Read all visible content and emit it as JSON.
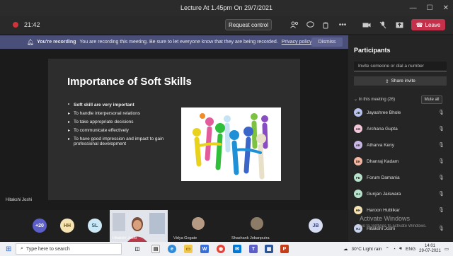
{
  "window": {
    "title": "Lecture At 1.45pm On 29/7/2021",
    "controls": [
      "—",
      "☐",
      "✕"
    ]
  },
  "toolbar": {
    "timer": "21:42",
    "request_control": "Request control",
    "leave_label": "Leave",
    "icons": [
      "participants-icon",
      "chat-icon",
      "reactions-icon",
      "more-icon",
      "camera-off-icon",
      "mic-off-icon",
      "share-icon"
    ]
  },
  "banner": {
    "title": "You're recording",
    "message": "You are recording this meeting. Be sure to let everyone know that they are being recorded.",
    "link": "Privacy policy",
    "dismiss": "Dismiss"
  },
  "slide": {
    "title": "Importance of Soft Skills",
    "bullets": [
      {
        "text": "Soft skill are very important",
        "main": true
      },
      {
        "text": "To handle interpersonal relations",
        "main": false
      },
      {
        "text": "To take appropriate decisions",
        "main": false
      },
      {
        "text": "To communicate effectively",
        "main": false
      },
      {
        "text": "To have good impression and impact to gain professional development",
        "main": false
      }
    ]
  },
  "presenter_name": "Hitakshi Joshi",
  "tiles": [
    {
      "initials": "+20",
      "color": "#5b5fc7",
      "text_color": "#ffffff"
    },
    {
      "initials": "HH",
      "color": "#f6e3b4",
      "text_color": "#6b5316"
    },
    {
      "initials": "SL",
      "color": "#cde8f5",
      "text_color": "#2b5d75"
    },
    {
      "initials": "JB",
      "color": "#d6dcf2",
      "text_color": "#3a4578"
    }
  ],
  "tile_names": {
    "video": "Hitakshi Joshi",
    "vidya": "Vidya Gogate",
    "shashank": "Shashank Jobanputra"
  },
  "participants": {
    "title": "Participants",
    "invite_placeholder": "Invite someone or dial a number",
    "share_invite": "Share invite",
    "in_meeting": "In this meeting (26)",
    "mute_all": "Mute all",
    "people": [
      {
        "name": "Jayashree Bhole",
        "initials": "JB",
        "color": "#b8c4ef"
      },
      {
        "name": "Archana Gupta",
        "initials": "AG",
        "color": "#f4c6d9"
      },
      {
        "name": "Atharva Keny",
        "initials": "AK",
        "color": "#c8b7e8"
      },
      {
        "name": "Dhanraj Kadam",
        "initials": "DK",
        "color": "#f3b8a4"
      },
      {
        "name": "Forum Damania",
        "initials": "FD",
        "color": "#b7e3cc"
      },
      {
        "name": "Gunjan Jaiswara",
        "initials": "GJ",
        "color": "#b7e3cc"
      },
      {
        "name": "Haroon Hublikar",
        "initials": "HH",
        "color": "#f6e3b4"
      },
      {
        "name": "Hitakshi Joshi",
        "initials": "HJ",
        "color": "#c9d3ee"
      }
    ]
  },
  "watermark": {
    "line1": "Activate Windows",
    "line2": "Go to Settings to activate Windows."
  },
  "taskbar": {
    "search_placeholder": "Type here to search",
    "weather": "30°C  Light rain",
    "lang": "ENG",
    "time": "14:01",
    "date": "29-07-2021"
  }
}
